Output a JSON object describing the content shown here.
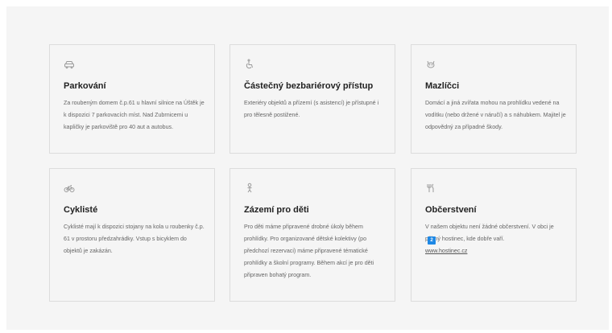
{
  "cards": [
    {
      "icon": "car-icon",
      "title": "Parkování",
      "text": "Za roubeným domem č.p.61 u hlavní silnice na Úštěk je k dispozici 7 parkovacích míst. Nad Zubrnicemi u kapličky je parkoviště pro 40 aut a autobus."
    },
    {
      "icon": "wheelchair-icon",
      "title": "Částečný bezbariérový přístup",
      "text": "Exteriéry objektů a přízemí (s asistencí) je přístupné i pro tělesně postižené."
    },
    {
      "icon": "pet-icon",
      "title": "Mazlíčci",
      "text": "Domácí a jiná zvířata mohou na prohlídku vedené na vodítku (nebo držené v náručí) a s náhubkem. Majitel je odpovědný za případné škody."
    },
    {
      "icon": "bicycle-icon",
      "title": "Cyklisté",
      "text": "Cyklisté mají k dispozici stojany na kola u roubenky č.p. 61 v prostoru předzahrádky. Vstup s bicyklem do objektů je zakázán."
    },
    {
      "icon": "child-icon",
      "title": "Zázemí pro děti",
      "text": "Pro děti máme připravené drobné úkoly během prohlídky. Pro organizované dětské kolektivy (po předchozí rezervaci) máme připravené tématické prohlídky a školní programy. Během akcí je pro děti připraven bohatý program."
    },
    {
      "icon": "fork-knife-icon",
      "title": "Občerstvení",
      "text": "V našem objektu není žádné občerstvení. V obci je pěkný hostinec, kde dobře vaří.",
      "link": "www.hostinec.cz"
    }
  ],
  "badge": "2"
}
